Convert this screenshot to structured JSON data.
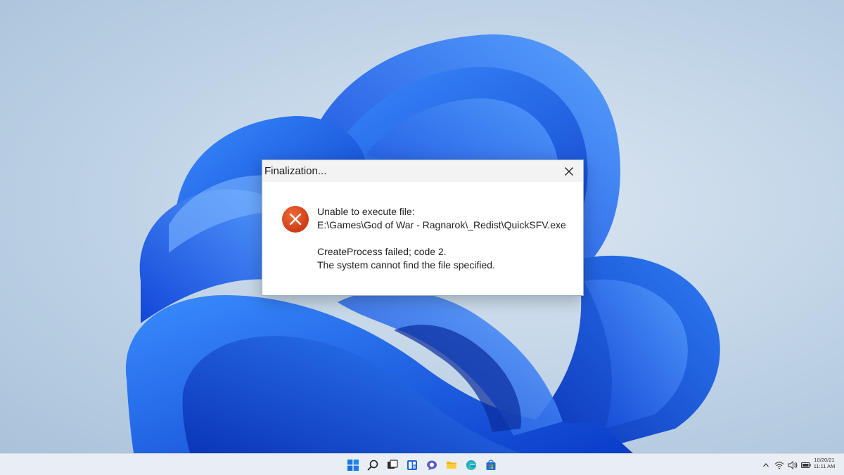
{
  "dialog": {
    "title": "Finalization...",
    "message_line1": "Unable to execute file:",
    "message_line2": "E:\\Games\\God of War - Ragnarok\\_Redist\\QuickSFV.exe",
    "message_line3": "CreateProcess failed; code 2.",
    "message_line4": "The system cannot find the file specified.",
    "icon": "error-icon",
    "close_icon": "close-icon"
  },
  "taskbar": {
    "items": [
      "start-icon",
      "search-icon",
      "task-view-icon",
      "widgets-icon",
      "chat-icon",
      "file-explorer-icon",
      "edge-icon",
      "store-icon"
    ],
    "tray": [
      "chevron-up-icon",
      "wifi-icon",
      "volume-icon",
      "battery-icon"
    ],
    "clock_date": "10/20/21",
    "clock_time": "11:11 AM"
  },
  "colors": {
    "wallpaper_bloom": "#1f63e8",
    "error_red": "#d9431c",
    "taskbar_bg": "#e9eef4"
  }
}
